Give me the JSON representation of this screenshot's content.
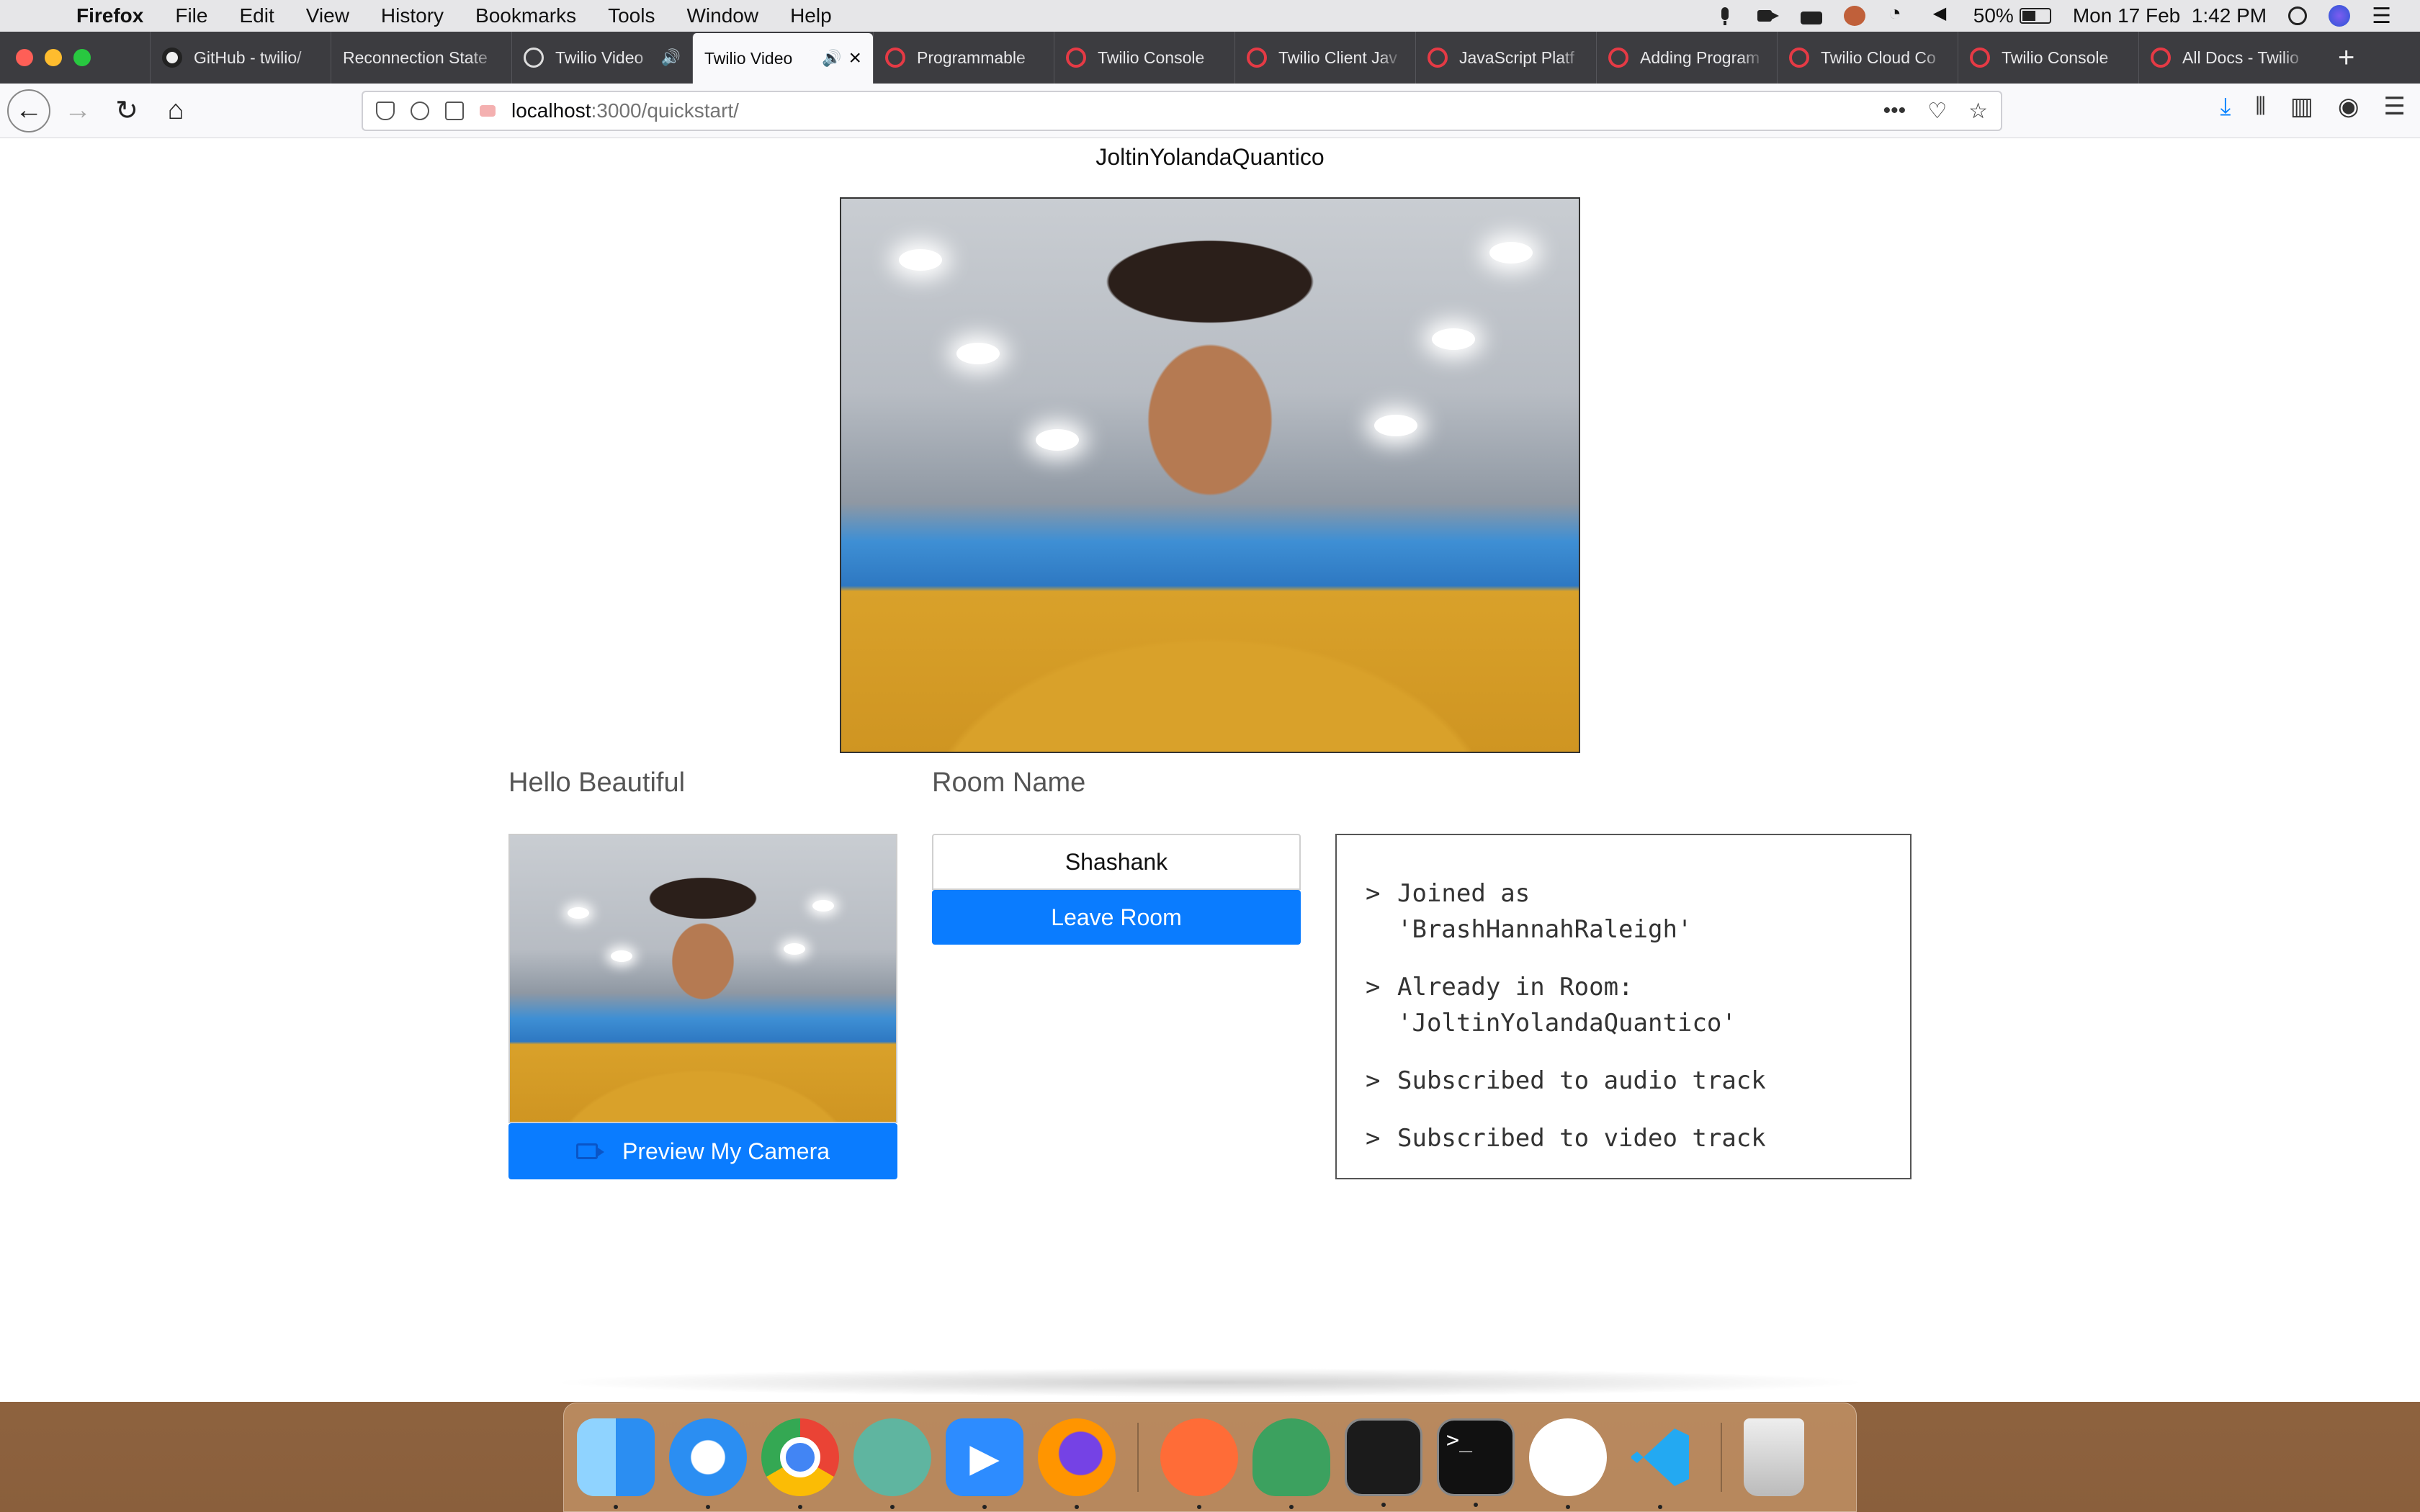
{
  "menubar": {
    "app": "Firefox",
    "items": [
      "File",
      "Edit",
      "View",
      "History",
      "Bookmarks",
      "Tools",
      "Window",
      "Help"
    ],
    "battery": "50%",
    "datetime": "Mon 17 Feb  1:42 PM",
    "battery_level": 0.5
  },
  "tabs": [
    {
      "label": "GitHub - twilio/",
      "favicon": "github-icon"
    },
    {
      "label": "Reconnection State",
      "favicon": "none"
    },
    {
      "label": "Twilio Video",
      "favicon": "globe-icon",
      "audio": true
    },
    {
      "label": "Twilio Video",
      "favicon": "none",
      "audio": true,
      "active": true
    },
    {
      "label": "Programmable",
      "favicon": "twilio-icon"
    },
    {
      "label": "Twilio Console",
      "favicon": "twilio-icon"
    },
    {
      "label": "Twilio Client Jav",
      "favicon": "twilio-icon"
    },
    {
      "label": "JavaScript Platf",
      "favicon": "twilio-icon"
    },
    {
      "label": "Adding Program",
      "favicon": "twilio-icon"
    },
    {
      "label": "Twilio Cloud Co",
      "favicon": "twilio-icon"
    },
    {
      "label": "Twilio Console",
      "favicon": "twilio-icon"
    },
    {
      "label": "All Docs - Twilio",
      "favicon": "twilio-icon"
    }
  ],
  "urlbar": {
    "host": "localhost",
    "path": ":3000/quickstart/"
  },
  "page": {
    "remote_participant": "JoltinYolandaQuantico",
    "local_label": "Hello Beautiful",
    "room_label": "Room Name",
    "room_value": "Shashank",
    "leave_button": "Leave Room",
    "preview_button": "Preview My Camera",
    "log": [
      {
        "caret": ">",
        "text": "Joined as\n'BrashHannahRaleigh'"
      },
      {
        "caret": ">",
        "text": "Already in Room:\n'JoltinYolandaQuantico'"
      },
      {
        "caret": ">",
        "text": "Subscribed to audio track"
      },
      {
        "caret": ">",
        "text": "Subscribed to video track"
      }
    ]
  },
  "colors": {
    "accent": "#0a7cff",
    "twilio_red": "#e53a45"
  },
  "dock": [
    "finder-icon",
    "safari-icon",
    "chrome-icon",
    "atom-icon",
    "zoom-icon",
    "firefox-icon",
    "postman-icon",
    "rocket-icon",
    "activity-monitor-icon",
    "terminal-icon",
    "slack-icon",
    "vscode-icon",
    "trash-icon"
  ]
}
